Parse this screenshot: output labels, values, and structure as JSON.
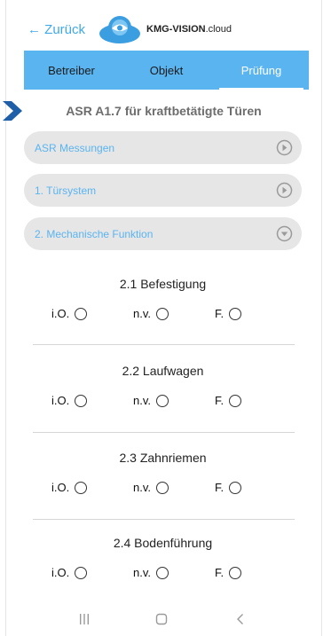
{
  "header": {
    "back_label": "← Zurück",
    "brand_bold": "KMG-VISION",
    "brand_rest": ".cloud"
  },
  "tabs": [
    {
      "label": "Betreiber",
      "active": false
    },
    {
      "label": "Objekt",
      "active": false
    },
    {
      "label": "Prüfung",
      "active": true
    }
  ],
  "title": "ASR A1.7 für kraftbetätigte Türen",
  "accordions": [
    {
      "label": "ASR Messungen",
      "icon": "play-circle-icon"
    },
    {
      "label": "1. Türsystem",
      "icon": "play-circle-icon"
    },
    {
      "label": "2. Mechanische Funktion",
      "icon": "chevron-down-circle-icon"
    }
  ],
  "checks": [
    {
      "heading": "2.1 Befestigung",
      "options": [
        "i.O.",
        "n.v.",
        "F."
      ]
    },
    {
      "heading": "2.2 Laufwagen",
      "options": [
        "i.O.",
        "n.v.",
        "F."
      ]
    },
    {
      "heading": "2.3 Zahnriemen",
      "options": [
        "i.O.",
        "n.v.",
        "F."
      ]
    },
    {
      "heading": "2.4 Bodenführung",
      "options": [
        "i.O.",
        "n.v.",
        "F."
      ]
    }
  ],
  "colors": {
    "accent": "#5ab4f0",
    "link": "#3fa9e8",
    "marker": "#1f5fa8",
    "accordion_bg": "#e6e6e6"
  }
}
